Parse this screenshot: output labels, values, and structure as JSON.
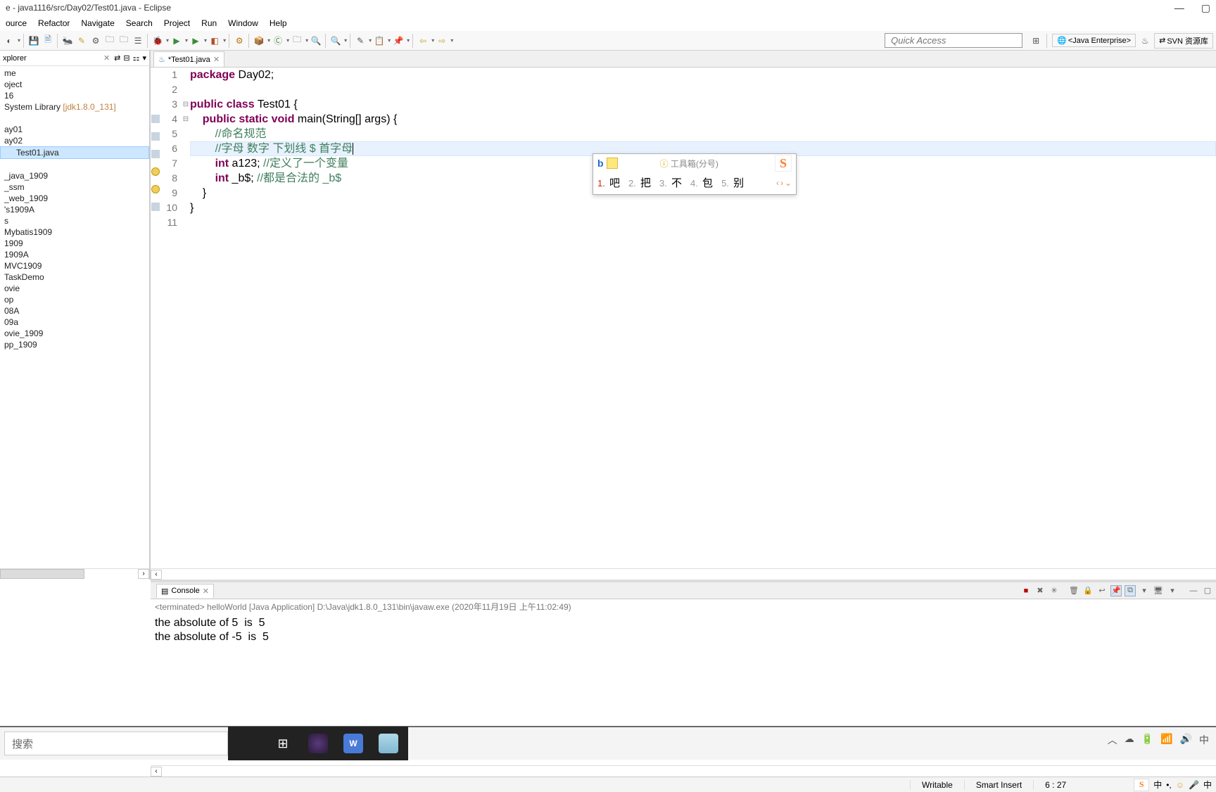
{
  "title_bar": {
    "text": "e - java1116/src/Day02/Test01.java - Eclipse"
  },
  "menu": {
    "items": [
      "ource",
      "Refactor",
      "Navigate",
      "Search",
      "Project",
      "Run",
      "Window",
      "Help"
    ]
  },
  "toolbar": {
    "quick_access": "Quick Access",
    "perspective": "<Java Enterprise>",
    "svn": "SVN 资源库"
  },
  "explorer": {
    "title": "xplorer",
    "items": [
      {
        "label": "me",
        "indent": 0
      },
      {
        "label": "oject",
        "indent": 0
      },
      {
        "label": "16",
        "indent": 0
      },
      {
        "label": "System Library",
        "indent": 0,
        "lib_ver": "[jdk1.8.0_131]"
      },
      {
        "label": "",
        "indent": 0
      },
      {
        "label": "ay01",
        "indent": 0
      },
      {
        "label": "ay02",
        "indent": 0
      },
      {
        "label": "Test01.java",
        "indent": 1,
        "selected": true
      },
      {
        "label": "",
        "indent": 0
      },
      {
        "label": "_java_1909",
        "indent": 0
      },
      {
        "label": "_ssm",
        "indent": 0
      },
      {
        "label": "_web_1909",
        "indent": 0
      },
      {
        "label": "'s1909A",
        "indent": 0
      },
      {
        "label": "s",
        "indent": 0
      },
      {
        "label": "Mybatis1909",
        "indent": 0
      },
      {
        "label": "1909",
        "indent": 0
      },
      {
        "label": "1909A",
        "indent": 0
      },
      {
        "label": "MVC1909",
        "indent": 0
      },
      {
        "label": "TaskDemo",
        "indent": 0
      },
      {
        "label": "ovie",
        "indent": 0
      },
      {
        "label": "op",
        "indent": 0
      },
      {
        "label": "08A",
        "indent": 0
      },
      {
        "label": "09a",
        "indent": 0
      },
      {
        "label": "ovie_1909",
        "indent": 0
      },
      {
        "label": "pp_1909",
        "indent": 0
      }
    ]
  },
  "editor": {
    "tab_name": "*Test01.java",
    "code": {
      "l1_kw1": "package",
      "l1_rest": " Day02;",
      "l3_kw1": "public",
      "l3_kw2": "class",
      "l3_rest": " Test01 {",
      "l4_kw1": "public",
      "l4_kw2": "static",
      "l4_kw3": "void",
      "l4_rest": " main(String[] args) {",
      "l5_cm": "//命名规范",
      "l6_cm": "//字母 数字 下划线 $ 首字母",
      "l7_kw": "int",
      "l7_rest": " a123; ",
      "l7_cm": "//定义了一个变量",
      "l8_kw": "int",
      "l8_rest": " _b$; ",
      "l8_cm": "//都是合法的 _b$",
      "l9": "    }",
      "l10": "}",
      "line_numbers": [
        "1",
        "2",
        "3",
        "4",
        "5",
        "6",
        "7",
        "8",
        "9",
        "10",
        "11"
      ]
    }
  },
  "ime": {
    "input": "b",
    "toolbox": "工具箱(分号)",
    "candidates": [
      {
        "n": "1.",
        "ch": "吧"
      },
      {
        "n": "2.",
        "ch": "把"
      },
      {
        "n": "3.",
        "ch": "不"
      },
      {
        "n": "4.",
        "ch": "包"
      },
      {
        "n": "5.",
        "ch": "别"
      }
    ]
  },
  "console": {
    "title": "Console",
    "header": "<terminated> helloWorld [Java Application] D:\\Java\\jdk1.8.0_131\\bin\\javaw.exe (2020年11月19日 上午11:02:49)",
    "out1": "the absolute of 5  is  5",
    "out2": "the absolute of -5  is  5"
  },
  "status": {
    "writable": "Writable",
    "insert": "Smart Insert",
    "pos": "6 : 27",
    "cn": "中"
  },
  "taskbar": {
    "search": "搜索"
  }
}
